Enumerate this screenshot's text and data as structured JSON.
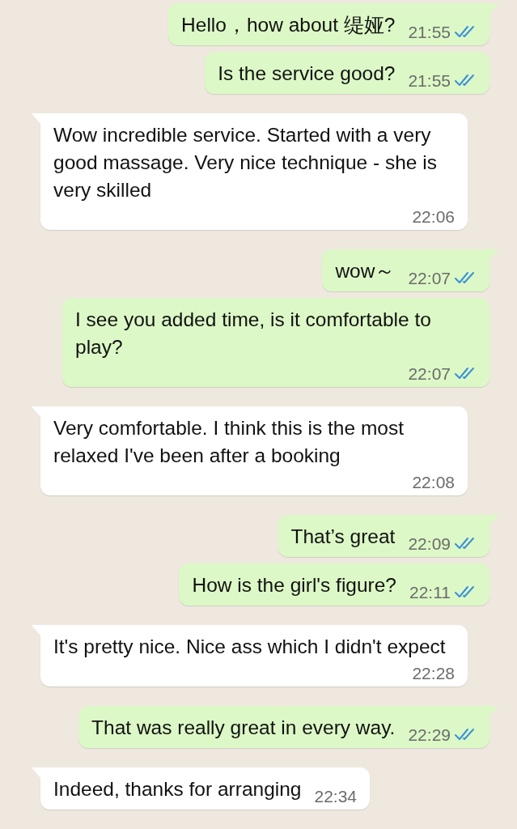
{
  "messages": [
    {
      "kind": "out",
      "text": "Hello，how about 缇娅?",
      "time": "21:55",
      "read": true
    },
    {
      "kind": "out",
      "text": "Is the service good?",
      "time": "21:55",
      "read": true
    },
    {
      "kind": "in",
      "text": "Wow incredible service. Started with a very good massage. Very nice technique - she is very skilled",
      "time": "22:06"
    },
    {
      "kind": "out",
      "text": "wow～",
      "time": "22:07",
      "read": true
    },
    {
      "kind": "out",
      "text": "I see you added time, is it comfortable to play?",
      "time": "22:07",
      "read": true
    },
    {
      "kind": "in",
      "text": "Very comfortable. I think this is the most relaxed I've been after a booking",
      "time": "22:08"
    },
    {
      "kind": "out",
      "text": "That’s great",
      "time": "22:09",
      "read": true
    },
    {
      "kind": "out",
      "text": "How is the girl's figure?",
      "time": "22:11",
      "read": true
    },
    {
      "kind": "in",
      "text": "It's pretty nice. Nice ass which I didn't expect",
      "time": "22:28"
    },
    {
      "kind": "out",
      "text": "That was really great in every way.",
      "time": "22:29",
      "read": true
    },
    {
      "kind": "in",
      "text": "Indeed, thanks for arranging",
      "time": "22:34"
    }
  ]
}
